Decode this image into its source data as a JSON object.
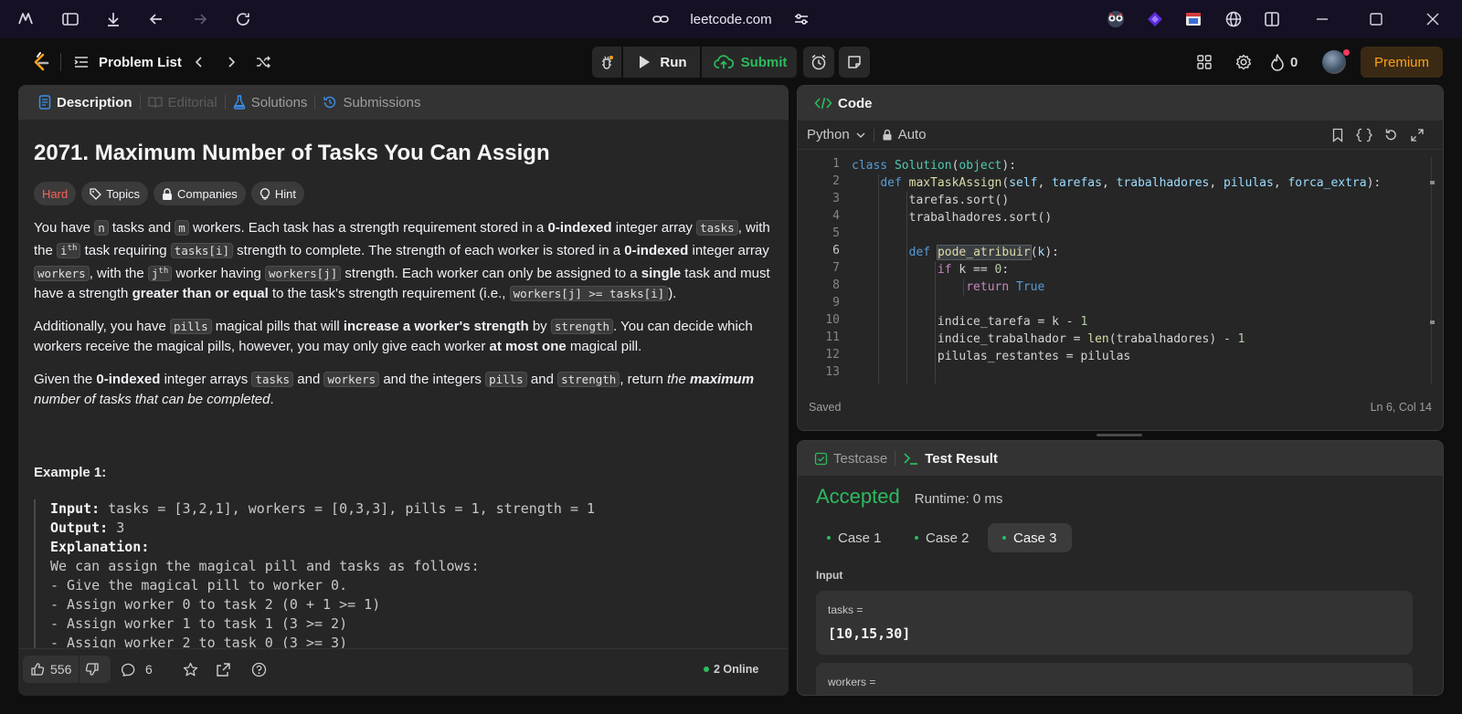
{
  "browser": {
    "url": "leetcode.com",
    "icons": [
      "browser-logo-icon",
      "sidebar-icon",
      "download-icon",
      "back-icon",
      "forward-icon",
      "reload-icon",
      "link-icon",
      "site-settings-icon",
      "extension-owl-icon",
      "extension-diamond-icon",
      "extension-cast-icon",
      "globe-icon",
      "split-view-icon",
      "minimize-icon",
      "maximize-icon",
      "close-icon"
    ]
  },
  "topbar": {
    "problem_list": "Problem List",
    "run": "Run",
    "submit": "Submit",
    "streak": "0",
    "premium": "Premium"
  },
  "left_tabs": {
    "description": "Description",
    "editorial": "Editorial",
    "solutions": "Solutions",
    "submissions": "Submissions"
  },
  "problem": {
    "title": "2071. Maximum Number of Tasks You Can Assign",
    "difficulty": "Hard",
    "tags": [
      "Topics",
      "Companies",
      "Hint"
    ],
    "p1": {
      "t1": "You have ",
      "c1": "n",
      "t2": " tasks and ",
      "c2": "m",
      "t3": " workers. Each task has a strength requirement stored in a ",
      "b1": "0-indexed",
      "t4": " integer array ",
      "c3": "tasks",
      "t5": ", with the ",
      "c4": "i",
      "s1": "th",
      "t6": " task requiring ",
      "c5": "tasks[i]",
      "t7": " strength to complete. The strength of each worker is stored in a ",
      "b2": "0-indexed",
      "t8": " integer array ",
      "c6": "workers",
      "t9": ", with the ",
      "c7": "j",
      "s2": "th",
      "t10": " worker having ",
      "c8": "workers[j]",
      "t11": " strength. Each worker can only be assigned to a ",
      "b3": "single",
      "t12": " task and must have a strength ",
      "b4": "greater than or equal",
      "t13": " to the task's strength requirement (i.e., ",
      "c9": "workers[j] >= tasks[i]",
      "t14": ")."
    },
    "p2": {
      "t1": "Additionally, you have ",
      "c1": "pills",
      "t2": " magical pills that will ",
      "b1": "increase a worker's strength",
      "t3": " by ",
      "c2": "strength",
      "t4": ". You can decide which workers receive the magical pills, however, you may only give each worker ",
      "b2": "at most one",
      "t5": " magical pill."
    },
    "p3": {
      "t1": "Given the ",
      "b1": "0-indexed",
      "t2": " integer arrays ",
      "c1": "tasks",
      "t3": " and ",
      "c2": "workers",
      "t4": " and the integers ",
      "c3": "pills",
      "t5": " and ",
      "c4": "strength",
      "t6": ", return ",
      "i1": "the ",
      "ib1": "maximum",
      "i2": " number of tasks that can be completed",
      "t7": "."
    },
    "example_title": "Example 1:",
    "example": {
      "input_label": "Input:",
      "input_value": " tasks = [3,2,1], workers = [0,3,3], pills = 1, strength = 1",
      "output_label": "Output:",
      "output_value": " 3",
      "explanation_label": "Explanation:",
      "lines": [
        "We can assign the magical pill and tasks as follows:",
        "- Give the magical pill to worker 0.",
        "- Assign worker 0 to task 2 (0 + 1 >= 1)",
        "- Assign worker 1 to task 1 (3 >= 2)",
        "- Assign worker 2 to task 0 (3 >= 3)"
      ]
    }
  },
  "footer": {
    "likes": "556",
    "comments": "6",
    "online": "2 Online"
  },
  "code_panel": {
    "title": "Code",
    "language": "Python",
    "auto": "Auto",
    "status": "Saved",
    "cursor": "Ln 6, Col 14",
    "line_numbers": [
      "1",
      "2",
      "3",
      "4",
      "5",
      "6",
      "7",
      "8",
      "9",
      "10",
      "11",
      "12",
      "13"
    ]
  },
  "test_panel": {
    "testcase_tab": "Testcase",
    "result_tab": "Test Result",
    "verdict": "Accepted",
    "runtime": "Runtime: 0 ms",
    "cases": [
      "Case 1",
      "Case 2",
      "Case 3"
    ],
    "selected_case": "Case 3",
    "input_label": "Input",
    "var1_name": "tasks =",
    "var1_value": "[10,15,30]",
    "var2_name": "workers ="
  },
  "colors": {
    "accepted": "#2cbb5d",
    "hard": "#f8615c",
    "premium": "#ffa116",
    "submit": "#2cbb5d"
  }
}
